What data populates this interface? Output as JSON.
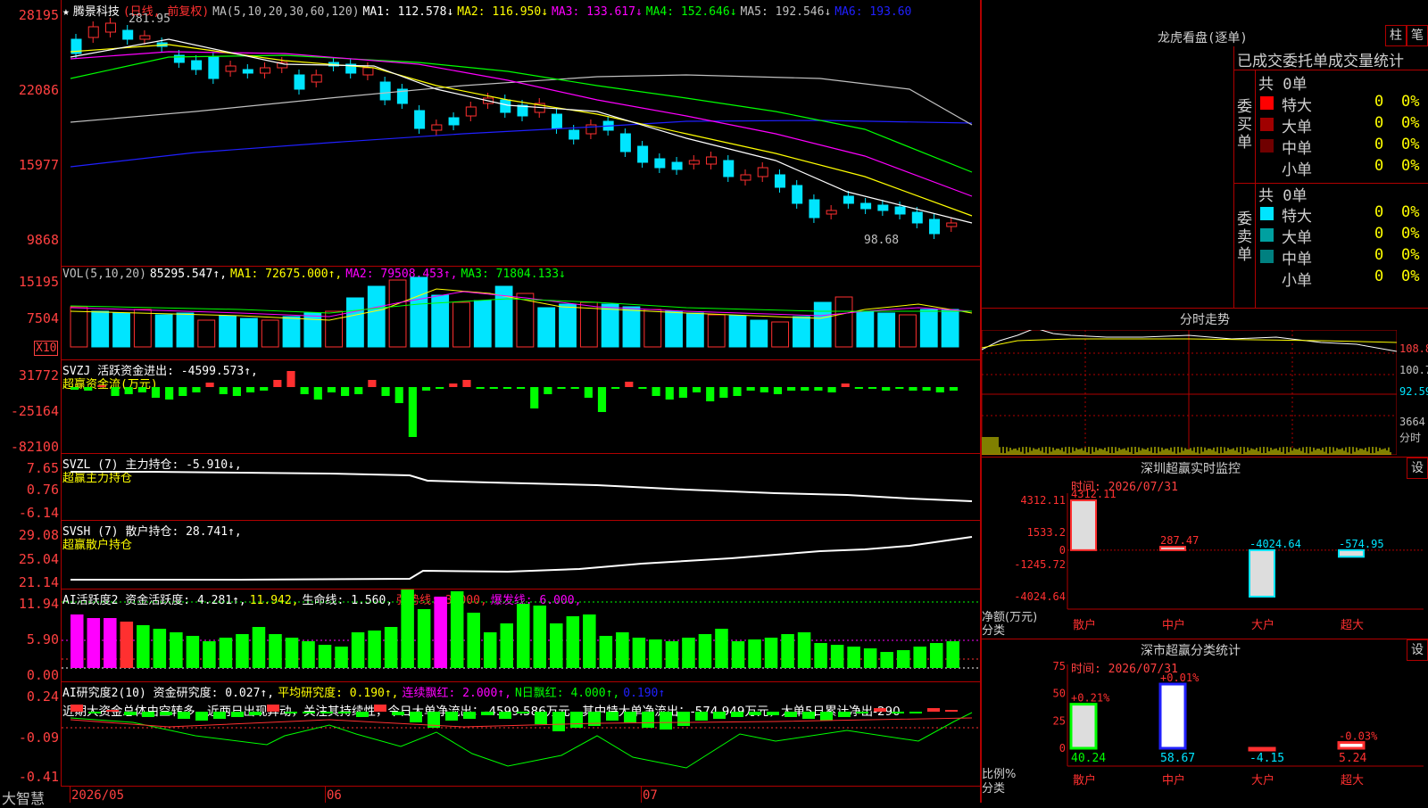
{
  "colors": {
    "up": "#ff3030",
    "down": "#00e5ff",
    "ma1": "#ffffff",
    "ma2": "#ffff00",
    "ma3": "#ff00ff",
    "ma4": "#00ff00",
    "ma5": "#c0c0c0",
    "ma6": "#2020ff",
    "green": "#00ff00",
    "bg": "#000000",
    "grid": "#b00000"
  },
  "main": {
    "title_star": "★",
    "stock_name": "腾景科技",
    "period": "(日线, 前复权)",
    "ma_params": "MA(5,10,20,30,60,120)",
    "ma1": "MA1: 112.578↓",
    "ma2": "MA2: 116.950↓",
    "ma3": "MA3: 133.617↓",
    "ma4": "MA4: 152.646↓",
    "ma5": "MA5: 192.546↓",
    "ma6": "MA6: 193.60",
    "high_label": "281.95",
    "low_label": "98.68",
    "y_ticks": [
      "28195",
      "22086",
      "15977",
      "9868"
    ]
  },
  "vol": {
    "params": "VOL(5,10,20)",
    "value": "85295.547↑,",
    "ma1": "MA1: 72675.000↑,",
    "ma2": "MA2: 79508.453↑,",
    "ma3": "MA3: 71804.133↓",
    "y_ticks": [
      "15195",
      "7504"
    ],
    "unit": "X10"
  },
  "svzj": {
    "title": "SVZJ  活跃资金进出: -4599.573↑,",
    "sub": "超赢资金流(万元)",
    "y_ticks": [
      "31772",
      "-25164",
      "-82100"
    ]
  },
  "svzl": {
    "title": "SVZL (7) 主力持仓: -5.910↓,",
    "sub": "超赢主力持仓",
    "y_ticks": [
      "7.65",
      "0.76",
      "-6.14"
    ]
  },
  "svsh": {
    "title": "SVSH (7) 散户持仓: 28.741↑,",
    "sub": "超赢散户持仓",
    "y_ticks": [
      "29.08",
      "25.04",
      "21.14"
    ]
  },
  "ai_active": {
    "title": "AI活跃度2 资金活跃度: 4.281↑,",
    "v2": "11.942,",
    "life": "生命线: 1.560,",
    "strong": "强势线: 3.000,",
    "burst": "爆发线: 6.000,",
    "y_ticks": [
      "11.94",
      "5.90",
      "0.00"
    ]
  },
  "ai_research": {
    "title": "AI研究度2(10) 资金研究度: 0.027↑,",
    "avg": "平均研究度: 0.190↑,",
    "cont": "连续飘红: 2.000↑,",
    "nday": "N日飘红: 4.000↑,",
    "last": "0.190↑",
    "comment": "近期大资金总体由空转多，近两日出现异动，关注其持续性，今日大单净流出：-4599.586万元，其中特大单净流出：-574.949万元，大单5日累计净出-290",
    "y_ticks": [
      "0.24",
      "-0.09",
      "-0.41"
    ]
  },
  "dates": {
    "d1": "2026/05",
    "d2": "06",
    "d3": "07"
  },
  "brand": "大智慧",
  "dragon": {
    "title": "龙虎看盘(逐单)",
    "btn1": "柱",
    "btn2": "笔",
    "header": "已成交委托单成交量统计",
    "buy_label": "委买单",
    "sell_label": "委卖单",
    "buy_total": "共 0单",
    "sell_total": "共 0单",
    "buy_rows": [
      {
        "name": "特大",
        "val": "0",
        "pct": "0%",
        "color": "#ff0000"
      },
      {
        "name": "大单",
        "val": "0",
        "pct": "0%",
        "color": "#a00000"
      },
      {
        "name": "中单",
        "val": "0",
        "pct": "0%",
        "color": "#700000"
      },
      {
        "name": "小单",
        "val": "0",
        "pct": "0%",
        "color": "#000000"
      }
    ],
    "sell_rows": [
      {
        "name": "特大",
        "val": "0",
        "pct": "0%",
        "color": "#00e5ff"
      },
      {
        "name": "大单",
        "val": "0",
        "pct": "0%",
        "color": "#00a0a0"
      },
      {
        "name": "中单",
        "val": "0",
        "pct": "0%",
        "color": "#008080"
      },
      {
        "name": "小单",
        "val": "0",
        "pct": "0%",
        "color": "#000000"
      }
    ]
  },
  "intraday": {
    "title": "分时走势",
    "p1": "108.8",
    "p2": "100.7",
    "p3": "92.59",
    "vol": "3664",
    "unit": "分时"
  },
  "sz_monitor": {
    "title": "深圳超赢实时监控",
    "btn": "设",
    "time": "时间: 2026/07/31",
    "y_ticks": [
      "4312.11",
      "1533.2",
      "0",
      "-1245.72",
      "-4024.64"
    ],
    "ylabel": "净额(万元)",
    "xlabel": "分类",
    "bars": [
      {
        "cat": "散户",
        "value": 4312.11,
        "label": "4312.11"
      },
      {
        "cat": "中户",
        "value": 287.47,
        "label": "287.47"
      },
      {
        "cat": "大户",
        "value": -4024.64,
        "label": "-4024.64"
      },
      {
        "cat": "超大",
        "value": -574.95,
        "label": "-574.95"
      }
    ]
  },
  "sz_class": {
    "title": "深市超赢分类统计",
    "btn": "设",
    "time": "时间: 2026/07/31",
    "y_ticks": [
      "75",
      "50",
      "25",
      "0"
    ],
    "ylabel": "比例%",
    "xlabel": "分类",
    "bars": [
      {
        "cat": "散户",
        "value": 40.24,
        "delta": "+0.21%",
        "label": "40.24"
      },
      {
        "cat": "中户",
        "value": 58.67,
        "delta": "+0.01%",
        "label": "58.67"
      },
      {
        "cat": "大户",
        "value": -4.15,
        "delta": "",
        "label": "-4.15"
      },
      {
        "cat": "超大",
        "value": 5.24,
        "delta": "-0.03%",
        "label": "5.24"
      }
    ]
  }
}
